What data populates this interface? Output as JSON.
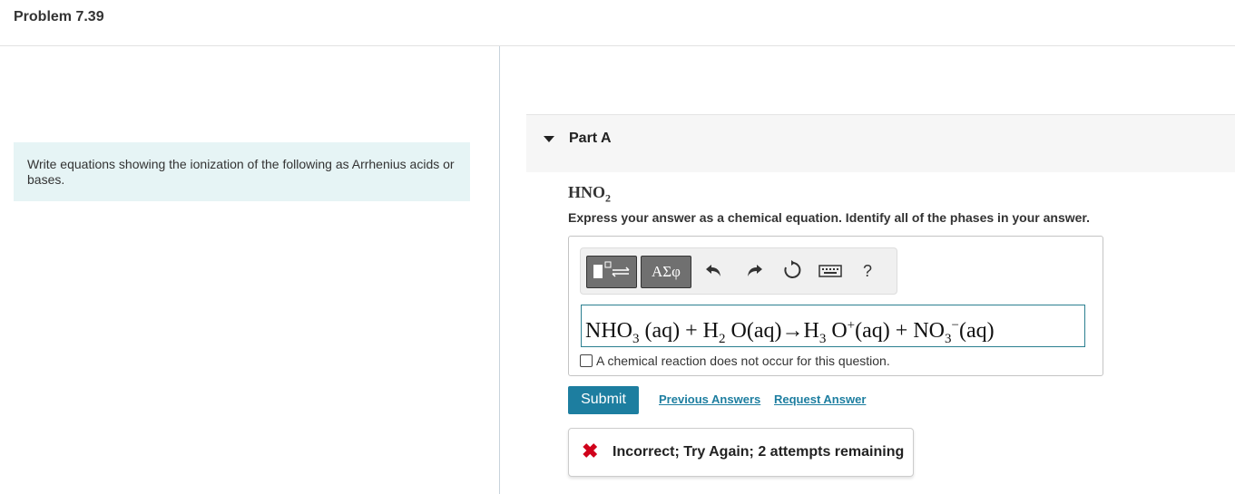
{
  "page": {
    "title": "Problem 7.39"
  },
  "problem": {
    "statement": "Write equations showing the ionization of the following as Arrhenius acids or bases."
  },
  "part": {
    "label": "Part A",
    "formula_main": "HNO",
    "formula_sub": "2",
    "instruction": "Express your answer as a chemical equation. Identify all of the phases in your answer."
  },
  "toolbar": {
    "templates_icon": "templates-icon",
    "greek_label": "ΑΣφ",
    "undo_icon": "undo-icon",
    "redo_icon": "redo-icon",
    "reset_icon": "reset-icon",
    "keyboard_icon": "keyboard-icon",
    "help_label": "?"
  },
  "answer": {
    "t1": "NHO",
    "s1": "3",
    "t2": " (aq) + H",
    "s2": "2",
    "t3": " O(aq)→H",
    "s3": "3",
    "t4": " O",
    "sup1": "+",
    "t5": "(aq) + NO",
    "s4": "3",
    "sup2": "−",
    "t6": "(aq)"
  },
  "no_reaction": {
    "label": "A chemical reaction does not occur for this question."
  },
  "actions": {
    "submit": "Submit",
    "previous_answers": "Previous Answers",
    "request_answer": "Request Answer"
  },
  "feedback": {
    "icon": "x-mark-icon",
    "message": "Incorrect; Try Again; 2 attempts remaining"
  },
  "colors": {
    "accent": "#1d7ea0",
    "error": "#d0021b",
    "problem_bg": "#e6f4f5"
  }
}
